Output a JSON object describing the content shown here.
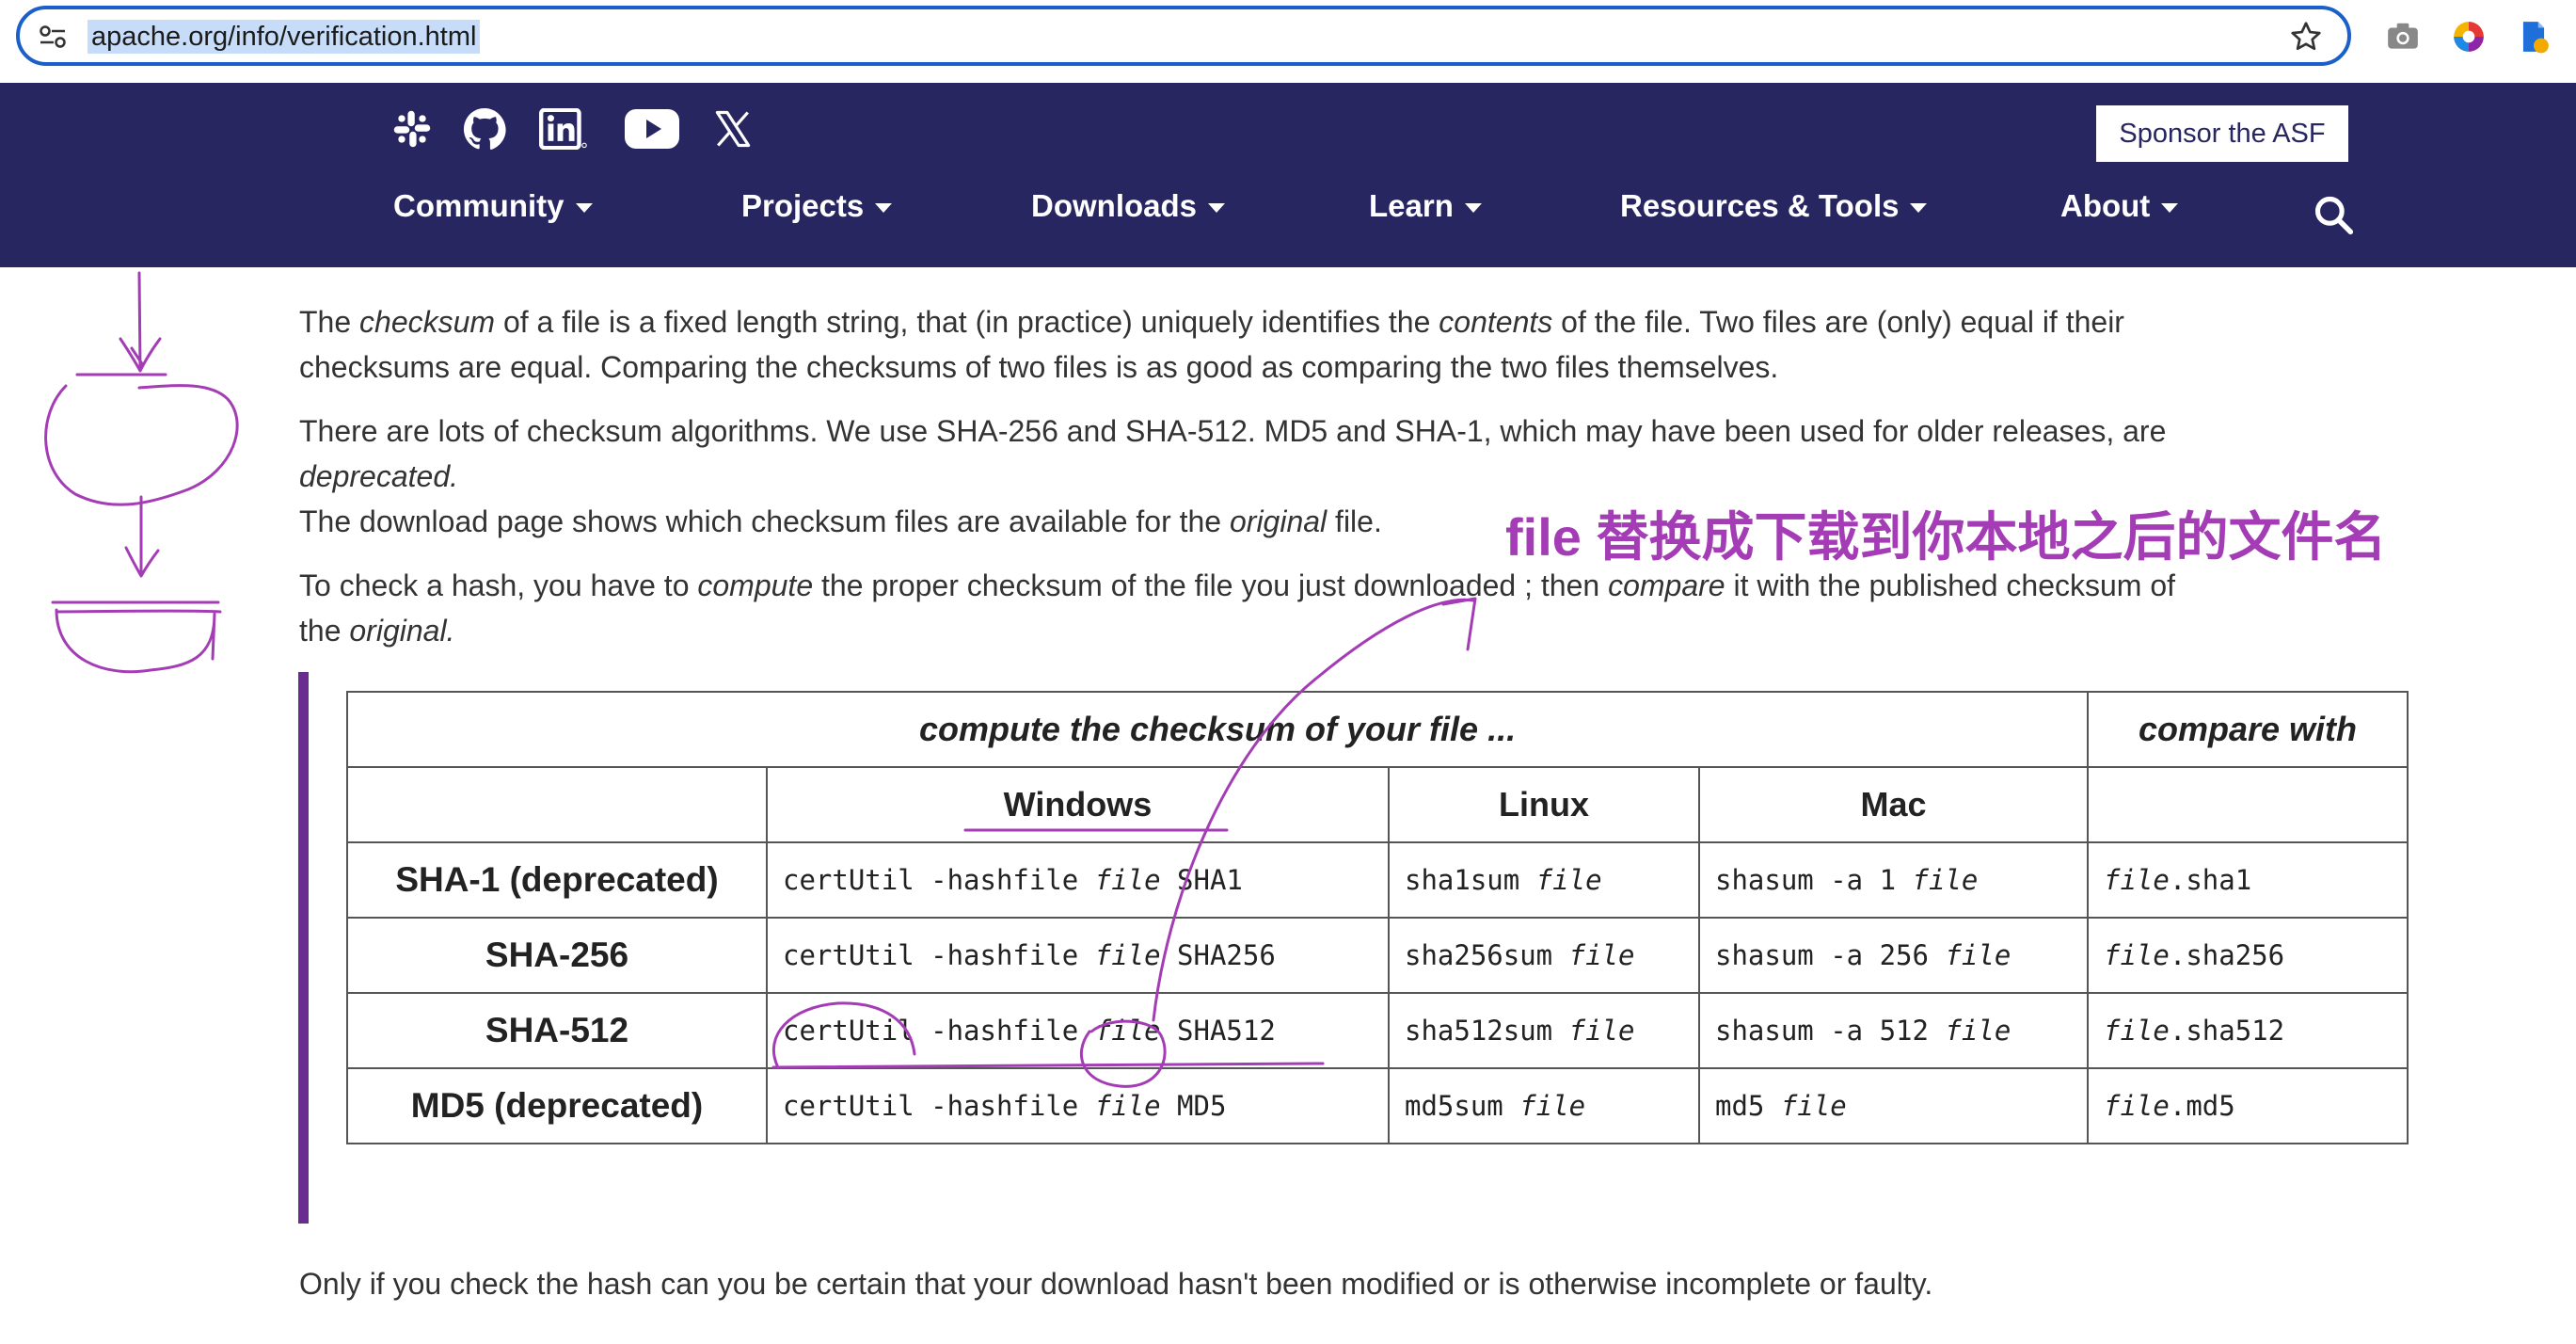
{
  "browser": {
    "url": "apache.org/info/verification.html",
    "accent_color": "#1a60c8",
    "toolbar_icons": [
      "camera-icon",
      "color-picker-icon",
      "bookmark-extension-icon"
    ]
  },
  "header": {
    "background_color": "#282661",
    "social_icons": [
      "slack-icon",
      "github-icon",
      "linkedin-icon",
      "youtube-icon",
      "x-icon"
    ],
    "sponsor_label": "Sponsor the ASF",
    "nav": [
      {
        "label": "Community"
      },
      {
        "label": "Projects"
      },
      {
        "label": "Downloads"
      },
      {
        "label": "Learn"
      },
      {
        "label": "Resources & Tools"
      },
      {
        "label": "About"
      }
    ]
  },
  "content": {
    "para1": [
      {
        "t": "The "
      },
      {
        "t": "checksum",
        "i": true
      },
      {
        "t": " of a file is a fixed length string, that (in practice) uniquely identifies the "
      },
      {
        "t": "contents",
        "i": true
      },
      {
        "t": " of the file. Two files are (only) equal if their"
      }
    ],
    "para1b": "checksums are equal. Comparing the checksums of two files is as good as comparing the two files themselves.",
    "para2": "There are lots of checksum algorithms. We use SHA-256 and SHA-512. MD5 and SHA-1, which may have been used for older releases, are",
    "para2b": "deprecated.",
    "para3": [
      {
        "t": "The download page shows which checksum files are available for the "
      },
      {
        "t": "original",
        "i": true
      },
      {
        "t": " file."
      }
    ],
    "para4": [
      {
        "t": "To check a hash, you have to "
      },
      {
        "t": "compute",
        "i": true
      },
      {
        "t": " the proper checksum of the file you just downloaded ; then "
      },
      {
        "t": "compare",
        "i": true
      },
      {
        "t": " it with the published checksum of"
      }
    ],
    "para4b": [
      {
        "t": "the "
      },
      {
        "t": "original.",
        "i": true
      }
    ],
    "final_para": "Only if you check the hash can you be certain that your download hasn't been modified or is otherwise incomplete or faulty."
  },
  "annotation": {
    "text": "file 替换成下载到你本地之后的文件名",
    "color": "#a43db5"
  },
  "table": {
    "header_compute": "compute the checksum of your file ...",
    "header_compare": "compare with",
    "os_headers": [
      "Windows",
      "Linux",
      "Mac"
    ],
    "rows": [
      {
        "label": "SHA-1 (deprecated)",
        "windows": [
          {
            "t": "certUtil -hashfile "
          },
          {
            "t": "file",
            "i": true
          },
          {
            "t": " SHA1"
          }
        ],
        "linux": [
          {
            "t": "sha1sum "
          },
          {
            "t": "file",
            "i": true
          }
        ],
        "mac": [
          {
            "t": "shasum -a 1 "
          },
          {
            "t": "file",
            "i": true
          }
        ],
        "compare": [
          {
            "t": "file",
            "i": true
          },
          {
            "t": ".sha1"
          }
        ]
      },
      {
        "label": "SHA-256",
        "windows": [
          {
            "t": "certUtil -hashfile "
          },
          {
            "t": "file",
            "i": true
          },
          {
            "t": " SHA256"
          }
        ],
        "linux": [
          {
            "t": "sha256sum "
          },
          {
            "t": "file",
            "i": true
          }
        ],
        "mac": [
          {
            "t": "shasum -a 256 "
          },
          {
            "t": "file",
            "i": true
          }
        ],
        "compare": [
          {
            "t": "file",
            "i": true
          },
          {
            "t": ".sha256"
          }
        ]
      },
      {
        "label": "SHA-512",
        "windows": [
          {
            "t": "certUtil -hashfile "
          },
          {
            "t": "file",
            "i": true
          },
          {
            "t": " SHA512"
          }
        ],
        "linux": [
          {
            "t": "sha512sum "
          },
          {
            "t": "file",
            "i": true
          }
        ],
        "mac": [
          {
            "t": "shasum -a 512 "
          },
          {
            "t": "file",
            "i": true
          }
        ],
        "compare": [
          {
            "t": "file",
            "i": true
          },
          {
            "t": ".sha512"
          }
        ]
      },
      {
        "label": "MD5 (deprecated)",
        "windows": [
          {
            "t": "certUtil -hashfile "
          },
          {
            "t": "file",
            "i": true
          },
          {
            "t": " MD5"
          }
        ],
        "linux": [
          {
            "t": "md5sum "
          },
          {
            "t": "file",
            "i": true
          }
        ],
        "mac": [
          {
            "t": "md5 "
          },
          {
            "t": "file",
            "i": true
          }
        ],
        "compare": [
          {
            "t": "file",
            "i": true
          },
          {
            "t": ".md5"
          }
        ]
      }
    ]
  }
}
